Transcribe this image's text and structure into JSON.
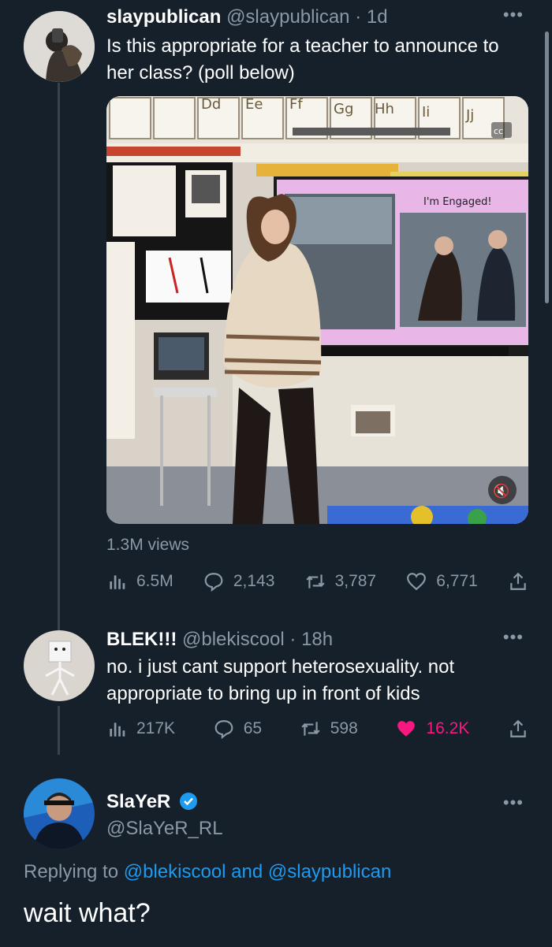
{
  "tweet1": {
    "name": "slaypublican",
    "handle": "@slaypublican",
    "time": "· 1d",
    "text": "Is this appropriate for a teacher to announce to her class? (poll below)",
    "screen_text": "I'm Engaged!",
    "views": "1.3M views",
    "stats": {
      "views": "6.5M",
      "replies": "2,143",
      "retweets": "3,787",
      "likes": "6,771"
    }
  },
  "tweet2": {
    "name": "BLEK!!!",
    "handle": "@blekiscool",
    "time": "· 18h",
    "text": "no. i just cant support heterosexuality. not appropriate to bring up in front of kids",
    "stats": {
      "views": "217K",
      "replies": "65",
      "retweets": "598",
      "likes": "16.2K"
    }
  },
  "tweet3": {
    "name": "SlaYeR",
    "handle": "@SlaYeR_RL",
    "reply_prefix": "Replying to",
    "mention1": "@blekiscool",
    "and": "and",
    "mention2": "@slaypublican",
    "text": "wait what?"
  },
  "colors": {
    "background": "#15202b",
    "muted": "#8b98a5",
    "link": "#1d9bf0",
    "like": "#f91880",
    "verified": "#1d9bf0"
  },
  "icons": [
    "views-icon",
    "reply-icon",
    "retweet-icon",
    "like-icon",
    "share-icon",
    "more-icon",
    "verified-icon",
    "mute-icon",
    "cc-icon"
  ]
}
